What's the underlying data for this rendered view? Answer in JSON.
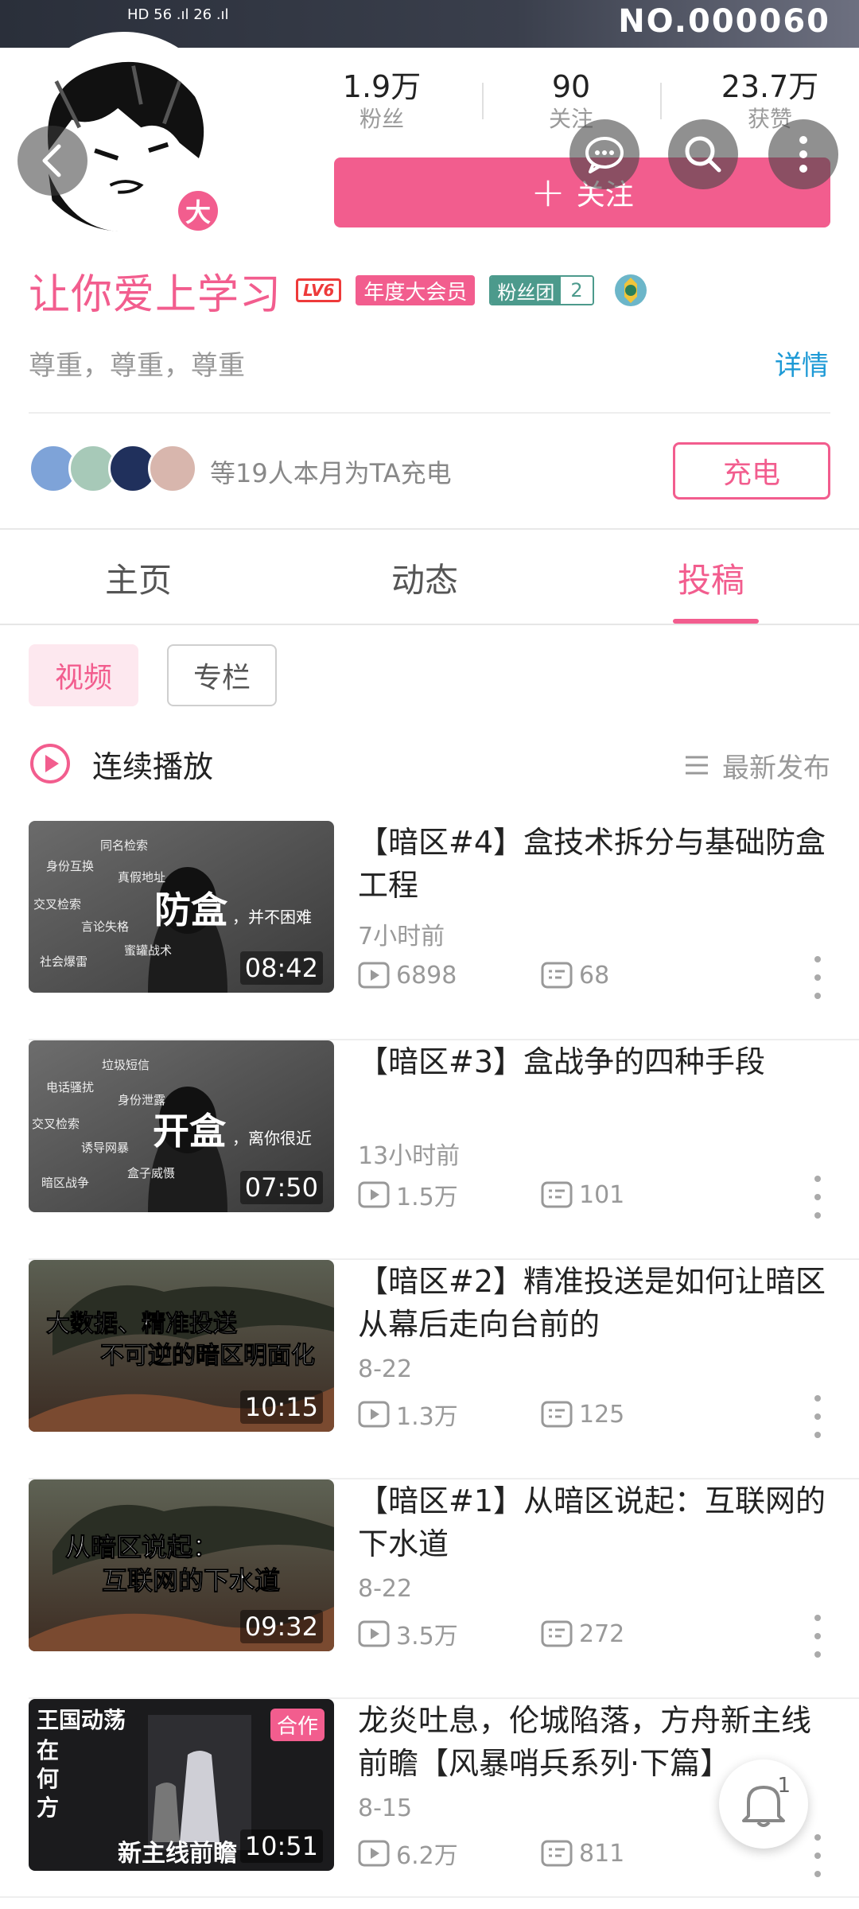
{
  "banner": {
    "no": "NO.000060"
  },
  "status_bar": {
    "left": "HD 56 .ıl 26 .ıl"
  },
  "avatar": {
    "badge": "大"
  },
  "stats": [
    {
      "num": "1.9万",
      "label": "粉丝"
    },
    {
      "num": "90",
      "label": "关注"
    },
    {
      "num": "23.7万",
      "label": "获赞"
    }
  ],
  "follow": {
    "label": "关注"
  },
  "profile": {
    "name": "让你爱上学习",
    "level": "LV6",
    "vip": "年度大会员",
    "fan_club": "粉丝团",
    "fan_level": "2",
    "sign": "尊重，尊重，尊重",
    "detail": "详情"
  },
  "charge": {
    "text": "等19人本月为TA充电",
    "button": "充电",
    "avatar_colors": [
      "#7ea3d8",
      "#a7c9b8",
      "#20305c",
      "#d8b6ad"
    ]
  },
  "tabs": [
    {
      "label": "主页"
    },
    {
      "label": "动态"
    },
    {
      "label": "投稿"
    }
  ],
  "subtabs": [
    {
      "label": "视频"
    },
    {
      "label": "专栏"
    }
  ],
  "playlist": {
    "label": "连续播放",
    "sort": "最新发布"
  },
  "videos": [
    {
      "title": "【暗区#4】盒技术拆分与基础防盒工程",
      "time": "7小时前",
      "views": "6898",
      "comments": "68",
      "duration": "08:42",
      "thumb_big": "防盒",
      "thumb_small": "，并不困难",
      "thumb_tags": [
        "同名检索",
        "身份互换",
        "真假地址",
        "交叉检索",
        "言论失格",
        "蜜罐战术",
        "社会爆雷"
      ]
    },
    {
      "title": "【暗区#3】盒战争的四种手段",
      "time": "13小时前",
      "views": "1.5万",
      "comments": "101",
      "duration": "07:50",
      "thumb_big": "开盒",
      "thumb_small": "，离你很近",
      "thumb_tags": [
        "垃圾短信",
        "电话骚扰",
        "身份泄露",
        "交叉检索",
        "诱导网暴",
        "盒子威慑",
        "暗区战争"
      ]
    },
    {
      "title": "【暗区#2】精准投送是如何让暗区从幕后走向台前的",
      "time": "8-22",
      "views": "1.3万",
      "comments": "125",
      "duration": "10:15",
      "thumb_line1": "大数据、精准投送",
      "thumb_line2": "不可逆的暗区明面化"
    },
    {
      "title": "【暗区#1】从暗区说起：互联网的下水道",
      "time": "8-22",
      "views": "3.5万",
      "comments": "272",
      "duration": "09:32",
      "thumb_line1": "从暗区说起：",
      "thumb_line2": "互联网的下水道"
    },
    {
      "title": "龙炎吐息，伦城陷落，方舟新主线前瞻【风暴哨兵系列·下篇】",
      "time": "8-15",
      "views": "6.2万",
      "comments": "811",
      "duration": "10:51",
      "coop": "合作",
      "thumb_vertical": [
        "王国动荡",
        "在",
        "何",
        "方"
      ],
      "thumb_bottom": "新主线前瞻"
    }
  ],
  "bell": {
    "count": "1"
  },
  "colors": {
    "accent": "#f25d8e",
    "link": "#1e9ad6"
  }
}
